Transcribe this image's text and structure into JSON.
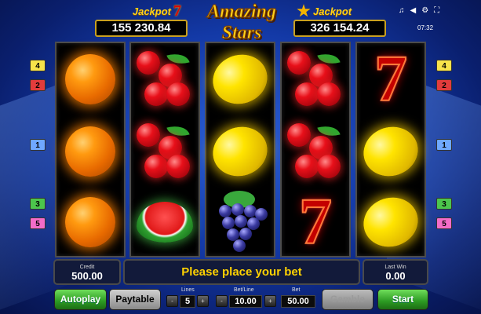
{
  "header": {
    "jackpot_left": {
      "label": "Jackpot",
      "emblem": "7",
      "value": "155 230.84"
    },
    "jackpot_right": {
      "label": "Jackpot",
      "emblem_icon": "star-icon",
      "value": "326 154.24"
    },
    "logo": {
      "line1": "Amazing",
      "line2": "Stars"
    },
    "system_icons": [
      "music-note-icon",
      "volume-icon",
      "settings-icon",
      "fullscreen-icon"
    ],
    "time": "07:32"
  },
  "reels": [
    [
      "orange",
      "orange",
      "orange"
    ],
    [
      "cherries",
      "cherries",
      "watermelon"
    ],
    [
      "lemon",
      "lemon",
      "grapes"
    ],
    [
      "cherries",
      "cherries",
      "seven"
    ],
    [
      "seven",
      "lemon",
      "lemon"
    ]
  ],
  "line_markers": {
    "left": [
      "4",
      "2",
      "1",
      "3",
      "5"
    ],
    "right": [
      "4",
      "2",
      "1",
      "3",
      "5"
    ]
  },
  "info": {
    "credit_label": "Credit",
    "credit_value": "500.00",
    "message": "Please place your bet",
    "last_win_label": "Last Win",
    "last_win_value": "0.00"
  },
  "controls": {
    "autoplay": "Autoplay",
    "paytable": "Paytable",
    "lines_label": "Lines",
    "lines_value": "5",
    "bet_line_label": "Bet/Line",
    "bet_line_value": "10.00",
    "bet_label": "Bet",
    "bet_value": "50.00",
    "gamble": "Gamble",
    "start": "Start",
    "minus": "-",
    "plus": "+"
  },
  "colors": {
    "accent_yellow": "#ffd200",
    "button_green": "#2c9a22",
    "background_blue": "#1339a6"
  }
}
